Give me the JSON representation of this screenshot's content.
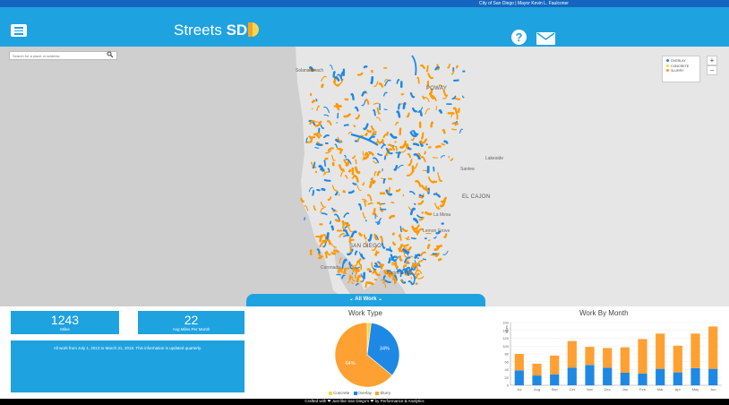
{
  "topbar": {
    "text": "City of San Diego  |  Mayor Kevin L. Faulconer"
  },
  "header": {
    "logo_text": "Streets ",
    "logo_bold": "SD",
    "help_icon": "question-circle-icon",
    "mail_icon": "envelope-icon"
  },
  "search": {
    "placeholder": "Search for a place or address",
    "icon": "search-icon"
  },
  "map": {
    "places": [
      {
        "name": "Solana Beach",
        "big": false
      },
      {
        "name": "POWAY",
        "big": true
      },
      {
        "name": "Lakeside",
        "big": false
      },
      {
        "name": "Santee",
        "big": false
      },
      {
        "name": "EL CAJON",
        "big": true
      },
      {
        "name": "La Mesa",
        "big": false
      },
      {
        "name": "Lemon Grove",
        "big": false
      },
      {
        "name": "SAN DIEGO",
        "big": true
      },
      {
        "name": "Coronado",
        "big": false
      },
      {
        "name": "National City",
        "big": false
      }
    ],
    "colors": {
      "overlay": "#1e88e5",
      "concrete": "#fdd835",
      "slurry": "#ff9800",
      "land": "#e8e8e8",
      "water": "#cfcfcf"
    }
  },
  "legend": {
    "items": [
      {
        "label": "OVERLAY",
        "color": "#1e88e5"
      },
      {
        "label": "CONCRETE",
        "color": "#fdd835"
      },
      {
        "label": "SLURRY",
        "color": "#ff9800"
      }
    ]
  },
  "zoom": {
    "in": "+",
    "out": "−"
  },
  "all_work_tab": {
    "label": "⌄ All Work ⌄"
  },
  "stats": {
    "miles": {
      "value": "1243",
      "label": "Miles"
    },
    "avg": {
      "value": "22",
      "label": "Avg Miles Per Month"
    }
  },
  "info_text": "All work from July 1, 2013 to March 31, 2018. This information is updated quarterly.",
  "chart_data": [
    {
      "type": "pie",
      "title": "Work Type",
      "categories": [
        "Concrete",
        "Overlay",
        "Slurry"
      ],
      "values": [
        2,
        34,
        64
      ],
      "colors": [
        "#fdd835",
        "#1e88e5",
        "#ffa033"
      ],
      "data_labels": [
        "",
        "34%",
        "64%"
      ]
    },
    {
      "type": "bar",
      "stacked": true,
      "title": "Work By Month",
      "ylabel": "Miles",
      "ylim": [
        0,
        160
      ],
      "yticks": [
        0,
        20,
        40,
        60,
        80,
        100,
        120,
        140,
        160
      ],
      "categories": [
        "Jul",
        "Aug",
        "Sep",
        "Oct",
        "Nov",
        "Dec",
        "Jan",
        "Feb",
        "Mar",
        "Apr",
        "May",
        "Jun"
      ],
      "series": [
        {
          "name": "Overlay",
          "color": "#1e88e5",
          "values": [
            38,
            25,
            28,
            45,
            52,
            45,
            32,
            30,
            42,
            33,
            44,
            42
          ]
        },
        {
          "name": "Slurry",
          "color": "#ffa033",
          "values": [
            42,
            30,
            48,
            68,
            46,
            50,
            65,
            88,
            90,
            68,
            88,
            108
          ]
        }
      ]
    }
  ],
  "footer": {
    "text": "Crafted with ❤ Just like San Diego's ❤ by Performance & Analytics"
  }
}
